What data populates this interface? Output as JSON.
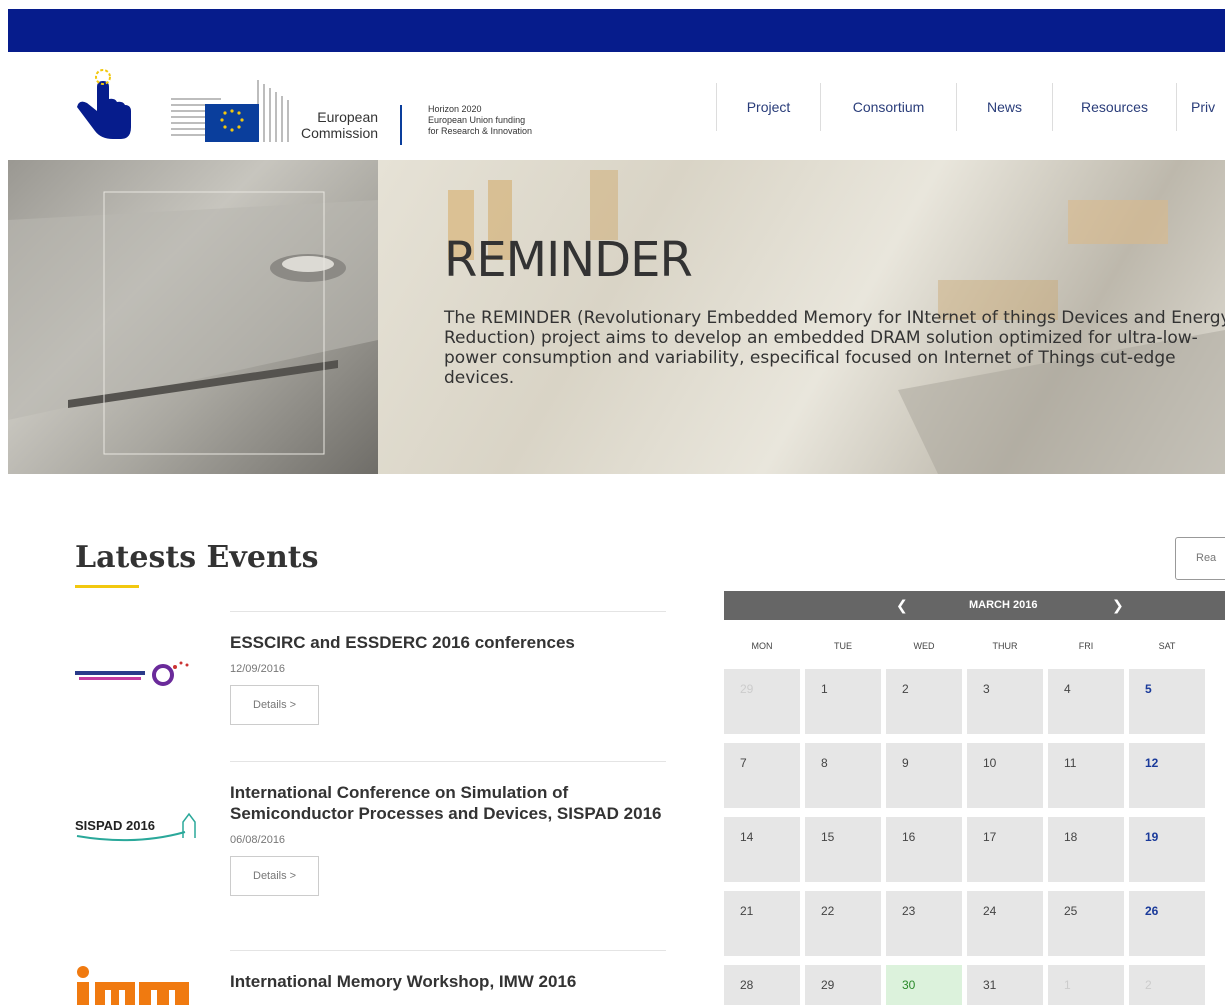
{
  "header": {
    "ec_line1": "European",
    "ec_line2": "Commission",
    "h2020_line1": "Horizon 2020",
    "h2020_line2": "European Union funding",
    "h2020_line3": "for Research & Innovation",
    "nav": [
      "Project",
      "Consortium",
      "News",
      "Resources",
      "Priv"
    ]
  },
  "hero": {
    "title": "REMINDER",
    "description": "The REMINDER (Revolutionary Embedded Memory for INternet of things Devices and Energy Reduction) project aims to develop an embedded DRAM solution optimized for ultra-low-power consumption and variability, especifical focused on Internet of Things cut-edge devices."
  },
  "events": {
    "title": "Latests Events",
    "items": [
      {
        "title": "ESSCIRC and ESSDERC 2016 conferences",
        "date": "12/09/2016",
        "button": "Details >",
        "logo": "ESSDERC ESSCIRC"
      },
      {
        "title": "International Conference on Simulation of Semiconductor Processes and Devices, SISPAD 2016",
        "date": "06/08/2016",
        "button": "Details >",
        "logo": "SISPAD 2016"
      },
      {
        "title": "International Memory Workshop, IMW 2016",
        "date": "",
        "button": "",
        "logo": "imw"
      }
    ]
  },
  "readmore": {
    "label": "Rea"
  },
  "calendar": {
    "month": "MARCH 2016",
    "prev_icon": "chevron-left-icon",
    "next_icon": "chevron-right-icon",
    "weekdays": [
      "MON",
      "TUE",
      "WED",
      "THUR",
      "FRI",
      "SAT"
    ],
    "weeks": [
      [
        "29",
        "1",
        "2",
        "3",
        "4",
        "5"
      ],
      [
        "7",
        "8",
        "9",
        "10",
        "11",
        "12"
      ],
      [
        "14",
        "15",
        "16",
        "17",
        "18",
        "19"
      ],
      [
        "21",
        "22",
        "23",
        "24",
        "25",
        "26"
      ],
      [
        "28",
        "29",
        "30",
        "31",
        "1",
        "2"
      ]
    ],
    "today": "30"
  },
  "colors": {
    "top_bar": "#061c8c",
    "nav_text": "#2a3d7a",
    "accent_yellow": "#f2c80f",
    "calendar_header": "#666666",
    "today_bg": "#dcf2dc"
  }
}
